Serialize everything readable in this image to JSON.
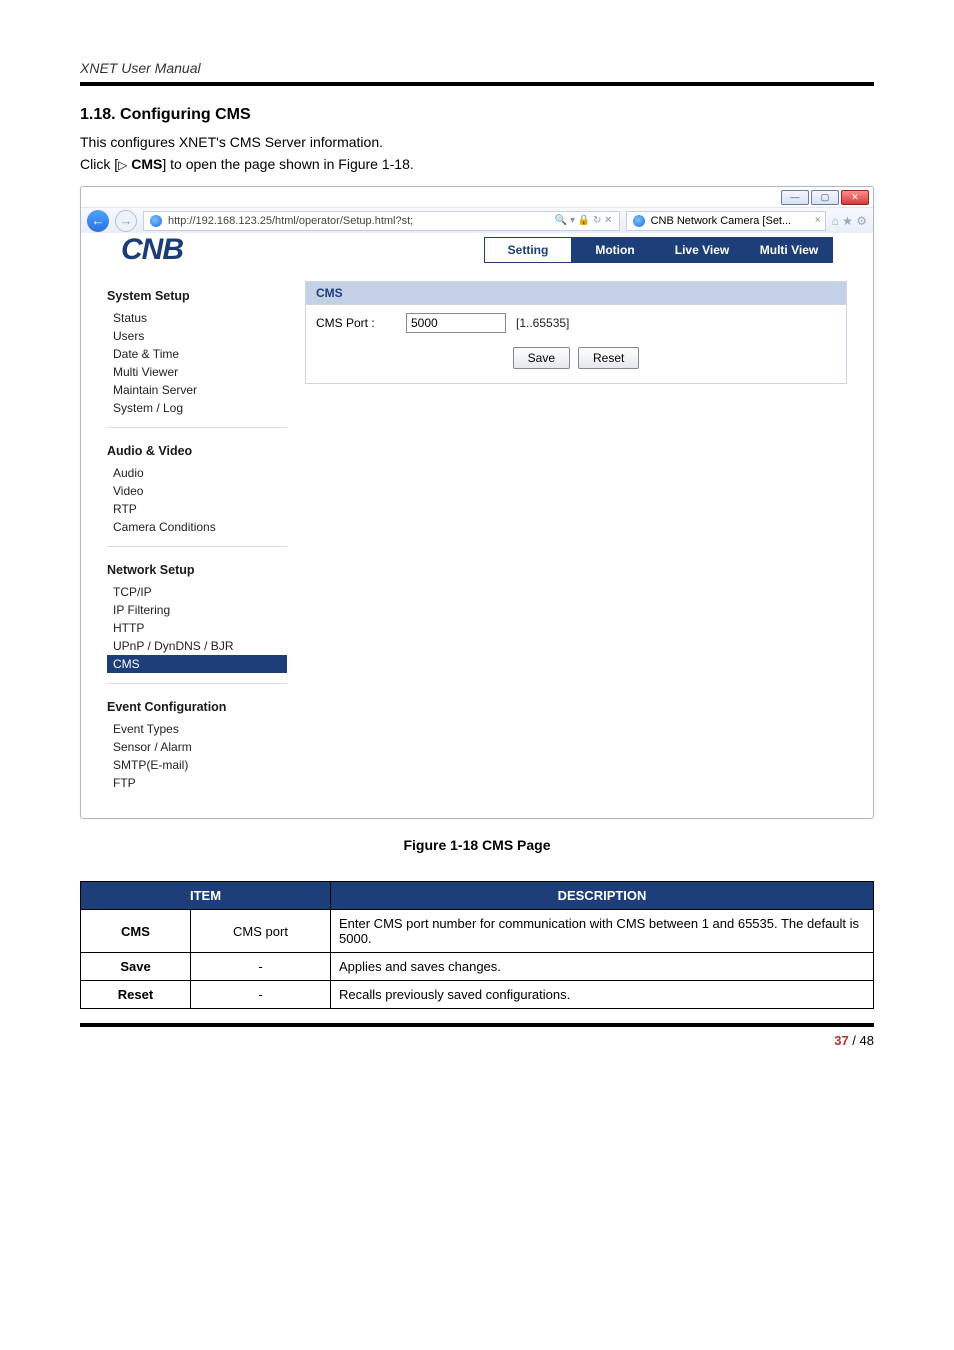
{
  "doc": {
    "header": "XNET User Manual",
    "section_title": "1.18. Configuring CMS",
    "intro": "This configures XNET's CMS Server information.",
    "click_prefix": "Click [",
    "click_icon": "▷",
    "click_label": "CMS",
    "click_suffix": "] to open the page shown in Figure 1-18.",
    "figure_caption": "Figure 1-18 CMS Page",
    "page_current": "37",
    "page_sep": " / ",
    "page_total": "48"
  },
  "window": {
    "btn_min": "—",
    "btn_max": "▢",
    "btn_close": "✕",
    "url": "http://192.168.123.25/html/operator/Setup.html?st;",
    "addr_icons": "🔍 ▾  🔒  ↻  ✕",
    "tab_title": "CNB Network Camera [Set...",
    "tab_close": "×",
    "right_icons": "⌂  ★  ⚙"
  },
  "app": {
    "logo": "CNB",
    "tabs": {
      "setting": "Setting",
      "motion": "Motion",
      "live": "Live View",
      "multi": "Multi View"
    }
  },
  "sidebar": {
    "g1": {
      "head": "System Setup",
      "items": [
        "Status",
        "Users",
        "Date & Time",
        "Multi Viewer",
        "Maintain Server",
        "System / Log"
      ]
    },
    "g2": {
      "head": "Audio & Video",
      "items": [
        "Audio",
        "Video",
        "RTP",
        "Camera Conditions"
      ]
    },
    "g3": {
      "head": "Network Setup",
      "items": [
        "TCP/IP",
        "IP Filtering",
        "HTTP",
        "UPnP / DynDNS / BJR",
        "CMS"
      ]
    },
    "g4": {
      "head": "Event Configuration",
      "items": [
        "Event Types",
        "Sensor / Alarm",
        "SMTP(E-mail)",
        "FTP"
      ]
    }
  },
  "panel": {
    "title": "CMS",
    "port_label": "CMS Port :",
    "port_value": "5000",
    "port_range": "[1..65535]",
    "save": "Save",
    "reset": "Reset"
  },
  "table": {
    "head_item": "ITEM",
    "head_desc": "DESCRIPTION",
    "r1c1": "CMS",
    "r1c2": "CMS port",
    "r1c3": "Enter CMS port number for communication with CMS between 1 and 65535. The default is 5000.",
    "r2c1": "Save",
    "r2c2": "-",
    "r2c3": "Applies and saves changes.",
    "r3c1": "Reset",
    "r3c2": "-",
    "r3c3": "Recalls previously saved configurations."
  }
}
